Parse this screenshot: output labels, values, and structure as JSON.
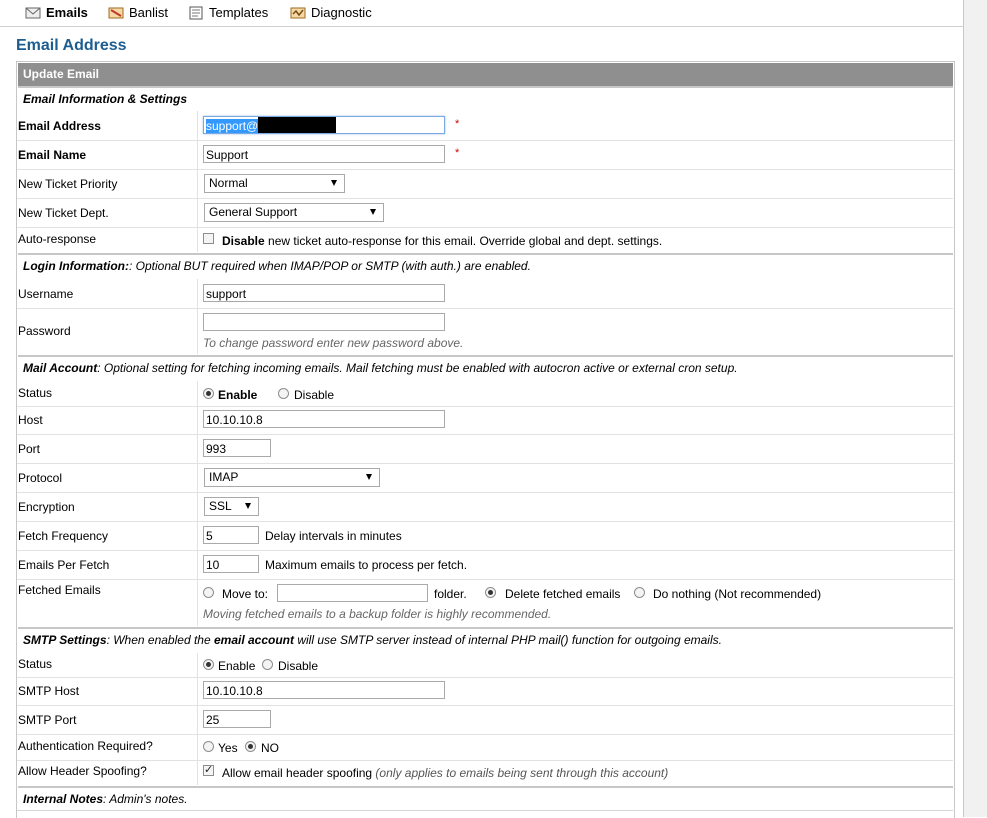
{
  "nav": {
    "items": [
      {
        "label": "Emails",
        "icon": "envelope-icon",
        "active": true
      },
      {
        "label": "Banlist",
        "icon": "banlist-icon",
        "active": false
      },
      {
        "label": "Templates",
        "icon": "templates-icon",
        "active": false
      },
      {
        "label": "Diagnostic",
        "icon": "diagnostic-icon",
        "active": false
      }
    ]
  },
  "page_title": "Email Address",
  "table_header": "Update Email",
  "sections": {
    "info": {
      "title": "Email Information & Settings"
    },
    "login": {
      "title": "Login Information:",
      "desc": ": Optional BUT required when IMAP/POP or SMTP (with auth.) are enabled."
    },
    "mail": {
      "title": "Mail Account",
      "desc": ": Optional setting for fetching incoming emails. Mail fetching must be enabled with autocron active or external cron setup."
    },
    "smtp": {
      "title": "SMTP Settings",
      "desc1": ": When enabled the ",
      "desc_bold": "email account",
      "desc2": " will use SMTP server instead of internal PHP mail() function for outgoing emails."
    },
    "notes": {
      "title": "Internal Notes",
      "desc": ": Admin's notes."
    }
  },
  "fields": {
    "email_address": {
      "label": "Email Address",
      "value": "support@",
      "required": "*"
    },
    "email_name": {
      "label": "Email Name",
      "value": "Support",
      "required": "*"
    },
    "priority": {
      "label": "New Ticket Priority",
      "value": "Normal"
    },
    "dept": {
      "label": "New Ticket Dept.",
      "value": "General Support"
    },
    "autoresp": {
      "label": "Auto-response",
      "bold": "Disable",
      "text": " new ticket auto-response for this email. Override global and dept. settings.",
      "checked": false
    },
    "username": {
      "label": "Username",
      "value": "support"
    },
    "password": {
      "label": "Password",
      "value": "",
      "hint": "To change password enter new password above."
    },
    "mail_status": {
      "label": "Status",
      "enable": "Enable",
      "disable": "Disable",
      "selected": "Enable"
    },
    "host": {
      "label": "Host",
      "value": "10.10.10.8"
    },
    "port": {
      "label": "Port",
      "value": "993"
    },
    "protocol": {
      "label": "Protocol",
      "value": "IMAP"
    },
    "encryption": {
      "label": "Encryption",
      "value": "SSL"
    },
    "fetch_freq": {
      "label": "Fetch Frequency",
      "value": "5",
      "note": "Delay intervals in minutes"
    },
    "per_fetch": {
      "label": "Emails Per Fetch",
      "value": "10",
      "note": "Maximum emails to process per fetch."
    },
    "fetched": {
      "label": "Fetched Emails",
      "move_to": "Move to:",
      "folder": "folder.",
      "folder_value": "",
      "delete": "Delete fetched emails",
      "nothing": "Do nothing (Not recommended)",
      "hint": "Moving fetched emails to a backup folder is highly recommended.",
      "selected": "delete"
    },
    "smtp_status": {
      "label": "Status",
      "enable": "Enable",
      "disable": "Disable",
      "selected": "Enable"
    },
    "smtp_host": {
      "label": "SMTP Host",
      "value": "10.10.10.8"
    },
    "smtp_port": {
      "label": "SMTP Port",
      "value": "25"
    },
    "auth": {
      "label": "Authentication Required?",
      "yes": "Yes",
      "no": "NO",
      "selected": "NO"
    },
    "spoof": {
      "label": "Allow Header Spoofing?",
      "text": "Allow email header spoofing",
      "note": " (only applies to emails being sent through this account)",
      "checked": true
    }
  },
  "colors": {
    "title": "#1d5d8f",
    "header_bg": "#8f8f8f",
    "section_bg": "#eeeeee",
    "required": "#d00000"
  }
}
